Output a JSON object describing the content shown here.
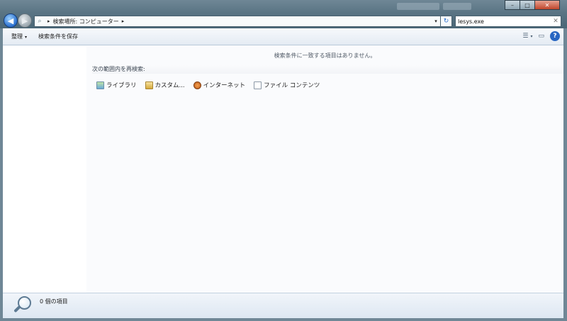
{
  "window": {
    "minimize_glyph": "–",
    "maximize_glyph": "□",
    "close_glyph": "✕"
  },
  "navigation": {
    "back_glyph": "◀",
    "forward_glyph": "▶"
  },
  "address_bar": {
    "arrow1": "▸",
    "path": "検索場所: コンピューター",
    "arrow2": "▸",
    "dropdown_glyph": "▾",
    "refresh_glyph": "↻"
  },
  "search": {
    "value": "lesys.exe",
    "clear_glyph": "✕"
  },
  "commands": {
    "organize": "整理",
    "save_search": "検索条件を保存",
    "caret": "▾",
    "help": "?"
  },
  "content": {
    "no_match": "検索条件に一致する項目はありません。",
    "search_again_label": "次の範囲内を再検索:",
    "locations": [
      {
        "label": "ライブラリ",
        "icon": "library-icon"
      },
      {
        "label": "カスタム...",
        "icon": "custom-folder-icon"
      },
      {
        "label": "インターネット",
        "icon": "internet-icon"
      },
      {
        "label": "ファイル コンテンツ",
        "icon": "file-contents-icon"
      }
    ]
  },
  "status": {
    "item_count": "0 個の項目"
  },
  "colors": {
    "frame": "#6f8796",
    "accent": "#2866c2"
  }
}
